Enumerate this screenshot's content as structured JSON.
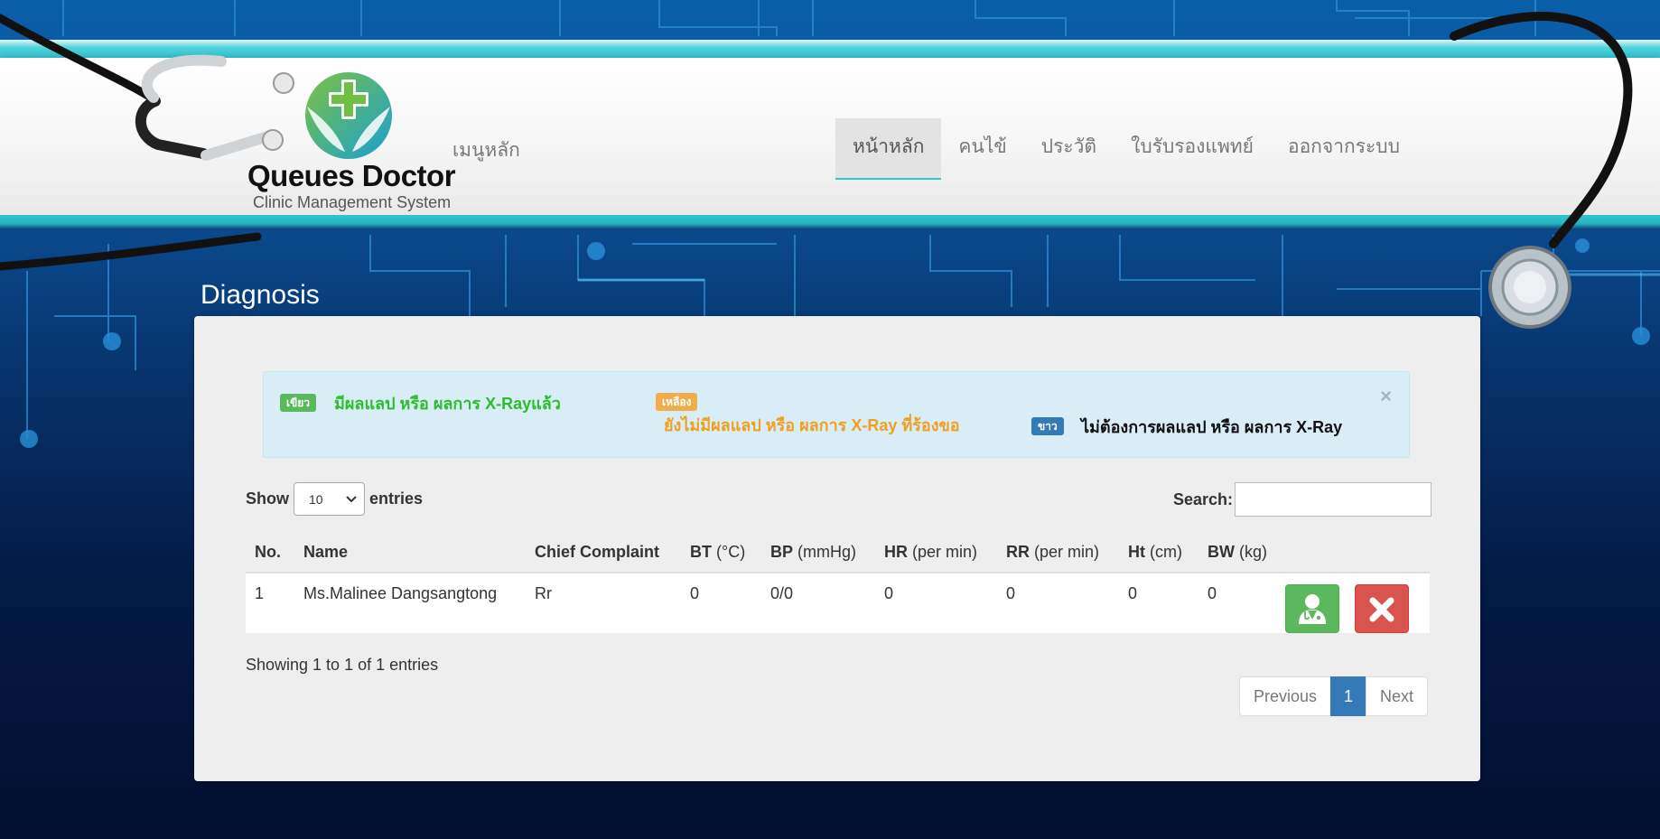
{
  "app": {
    "logo_title": "Queues Doctor",
    "logo_subtitle": "Clinic Management System"
  },
  "nav": {
    "brand": "เมนูหลัก",
    "items": [
      {
        "label": "หน้าหลัก",
        "active": true
      },
      {
        "label": "คนไข้"
      },
      {
        "label": "ประวัติ"
      },
      {
        "label": "ใบรับรองแพทย์"
      },
      {
        "label": "ออกจากระบบ"
      }
    ]
  },
  "page": {
    "title": "Diagnosis"
  },
  "legend": {
    "green_badge": "เขียว",
    "green_text": "มีผลแลป หรือ ผลการ X-Rayแล้ว",
    "yellow_badge": "เหลือง",
    "yellow_text": "ยังไม่มีผลแลป หรือ ผลการ X-Ray ที่ร้องขอ",
    "white_badge": "ขาว",
    "white_text": "ไม่ต้องการผลแลป หรือ ผลการ X-Ray",
    "close": "×",
    "colors": {
      "green": "#5cb85c",
      "yellow": "#f0ad4e",
      "blue": "#337ab7",
      "green_text": "#2ebd2e",
      "yellow_text": "#f0a020"
    }
  },
  "table_controls": {
    "show_label": "Show",
    "page_size": "10",
    "entries_label": "entries",
    "search_label": "Search:",
    "search_value": ""
  },
  "table": {
    "headers": [
      {
        "bold": "No.",
        "unit": ""
      },
      {
        "bold": "Name",
        "unit": ""
      },
      {
        "bold": "Chief Complaint",
        "unit": ""
      },
      {
        "bold": "BT",
        "unit": " (°C)"
      },
      {
        "bold": "BP",
        "unit": " (mmHg)"
      },
      {
        "bold": "HR",
        "unit": " (per min)"
      },
      {
        "bold": "RR",
        "unit": " (per min)"
      },
      {
        "bold": "Ht",
        "unit": " (cm)"
      },
      {
        "bold": "BW",
        "unit": " (kg)"
      }
    ],
    "rows": [
      {
        "no": "1",
        "name": "Ms.Malinee Dangsangtong",
        "complaint": "Rr",
        "bt": "0",
        "bp": "0/0",
        "hr": "0",
        "rr": "0",
        "ht": "0",
        "bw": "0"
      }
    ]
  },
  "footer": {
    "info": "Showing 1 to 1 of 1 entries",
    "previous": "Previous",
    "current_page": "1",
    "next": "Next"
  }
}
